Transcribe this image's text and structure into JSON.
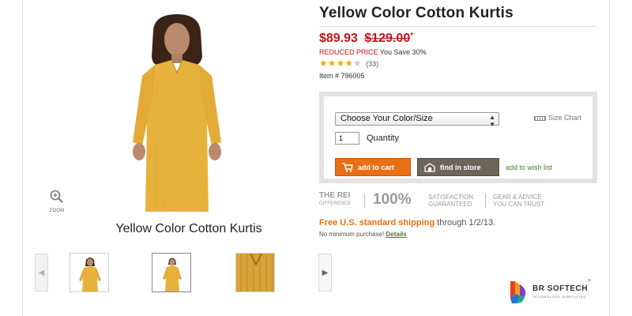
{
  "product": {
    "title": "Yellow Color Cotton Kurtis",
    "image_caption": "Yellow Color Cotton Kurtis",
    "price_current": "$89.93",
    "price_original": "$129.00",
    "price_asterisk": "*",
    "reduced_label": "REDUCED PRICE",
    "savings": "You Save 30%",
    "rating_stars": 4,
    "rating_count": "(33)",
    "item_number": "Item # 796005"
  },
  "gallery": {
    "zoom_label": "ZOOM",
    "prev_arrow": "◀",
    "next_arrow": "▶"
  },
  "buybox": {
    "option_select": "Choose Your Color/Size",
    "size_chart": "Size Chart",
    "quantity_value": "1",
    "quantity_label": "Quantity",
    "add_to_cart": "add to cart",
    "find_in_store": "find in store",
    "wish_list": "add to wish list"
  },
  "rei_strip": {
    "rei": "THE REI",
    "difference": "DIFFERENCE",
    "percent": "100%",
    "satisfaction": "SATISFACTION",
    "guaranteed": "GUARANTEED",
    "gear_advice": "GEAR & ADVICE",
    "you_can_trust": "YOU CAN TRUST"
  },
  "shipping": {
    "headline": "Free U.S. standard shipping",
    "through": " through 1/2/13.",
    "minimum": "No minimum purchase! ",
    "details": "Details"
  },
  "brand": {
    "name": "BR SOFTECH",
    "tagline": "TECHNOLOGY SIMPLIFIED",
    "registered": "®"
  },
  "colors": {
    "price_red": "#c0161b",
    "cart_orange": "#e86f16",
    "store_brown": "#6e6559",
    "link_green": "#4a7a2e",
    "star_gold": "#f1a81b"
  }
}
